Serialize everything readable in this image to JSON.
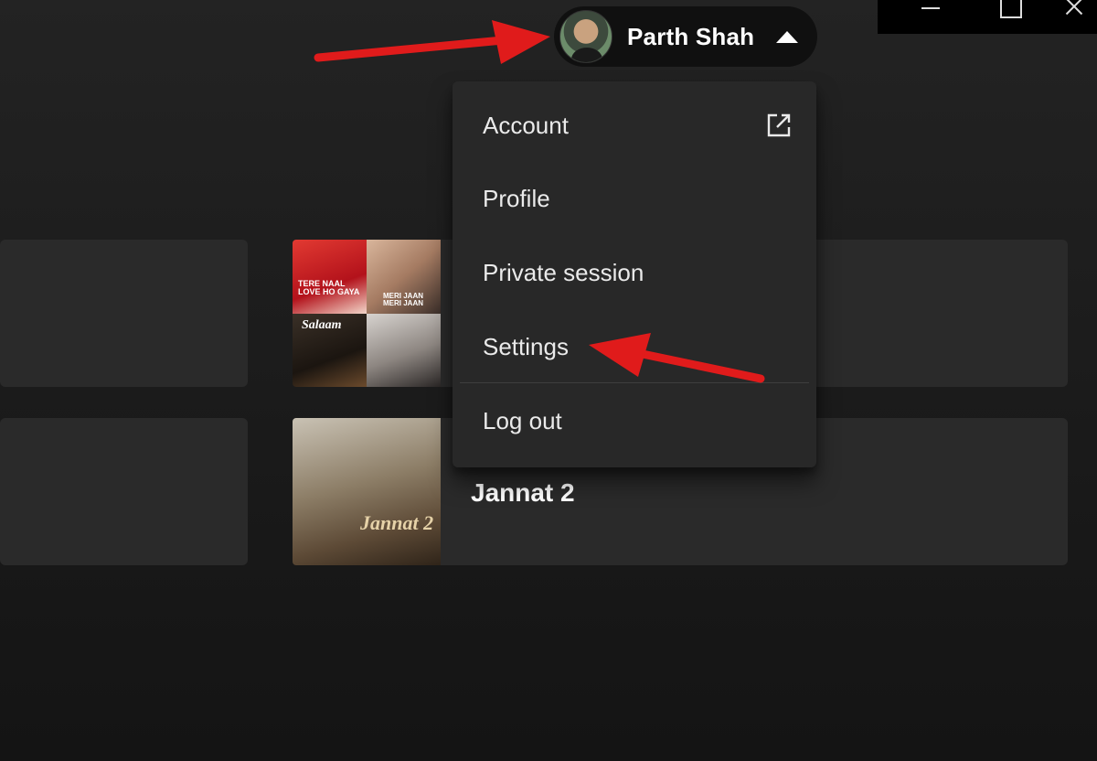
{
  "user": {
    "name": "Parth Shah"
  },
  "menu": {
    "items": [
      {
        "label": "Account",
        "external": true
      },
      {
        "label": "Profile"
      },
      {
        "label": "Private session"
      },
      {
        "label": "Settings"
      },
      {
        "label": "Log out"
      }
    ]
  },
  "cards": {
    "second_title": "Jannat 2",
    "cover_tiles": [
      "Tere Naal Love Ho Gaya",
      "Meri Jaan Meri Jaan",
      "Salaam",
      "Jannat 2"
    ]
  },
  "icons": {
    "caret": "caret-up-icon",
    "external": "external-link-icon"
  },
  "colors": {
    "accent_arrow": "#e01b1b",
    "menu_bg": "#282828",
    "pill_bg": "#101010"
  }
}
